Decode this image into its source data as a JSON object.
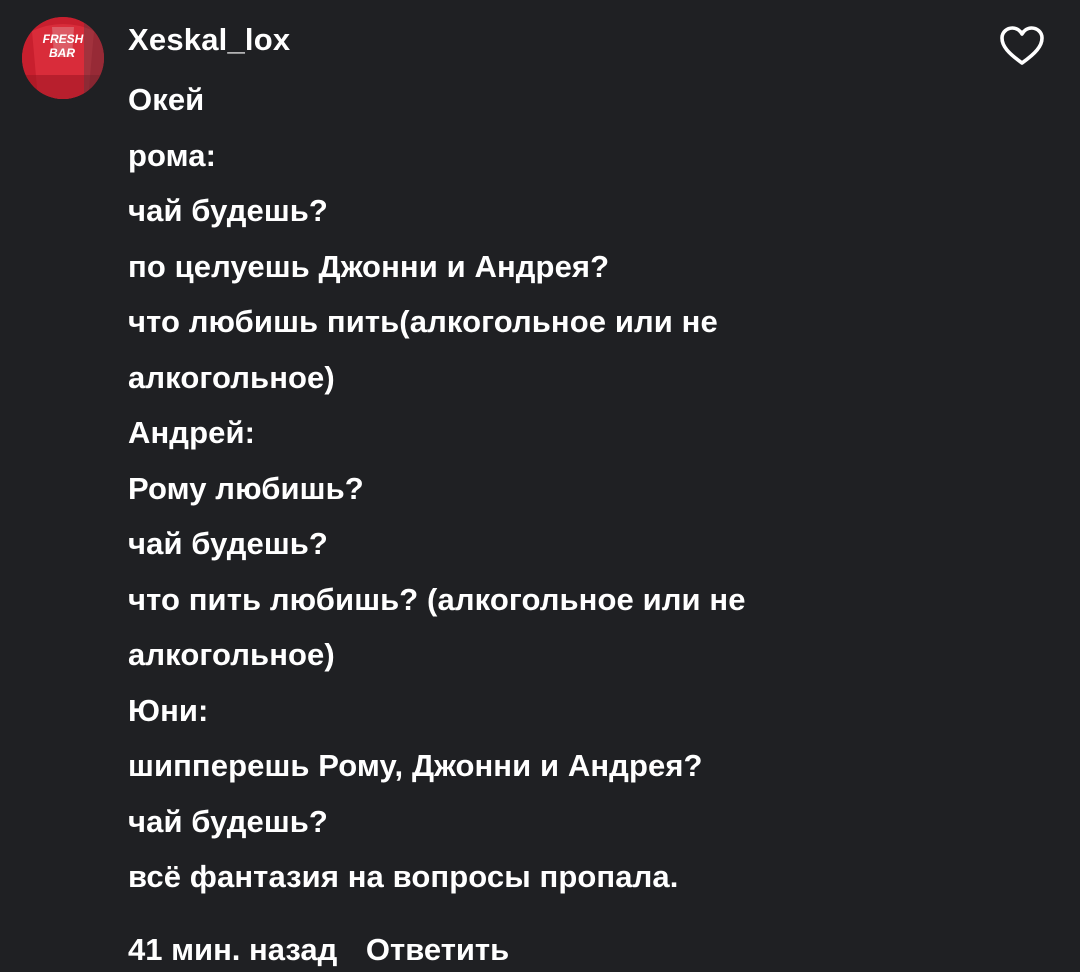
{
  "comment": {
    "username": "Xeskal_lox",
    "avatar_icon": "user-avatar-red-cup",
    "avatar_text": "FRESH BAR",
    "like_icon": "heart-outline-icon",
    "lines": [
      "Окей",
      "рома:",
      "чай будешь?",
      "по целуешь Джонни и Андрея?",
      "что любишь пить(алкогольное или не",
      "алкогольное)",
      "Андрей:",
      "Рому любишь?",
      "чай будешь?",
      "что пить любишь? (алкогольное или не",
      "алкогольное)",
      "Юни:",
      "шипперешь Рому, Джонни и Андрея?",
      "чай будешь?",
      "всё фантазия на вопросы пропала."
    ],
    "time_ago": "41 мин. назад",
    "reply_label": "Ответить"
  },
  "colors": {
    "background": "#1f2023",
    "text": "#ffffff",
    "avatar_accent": "#c21f2e"
  }
}
